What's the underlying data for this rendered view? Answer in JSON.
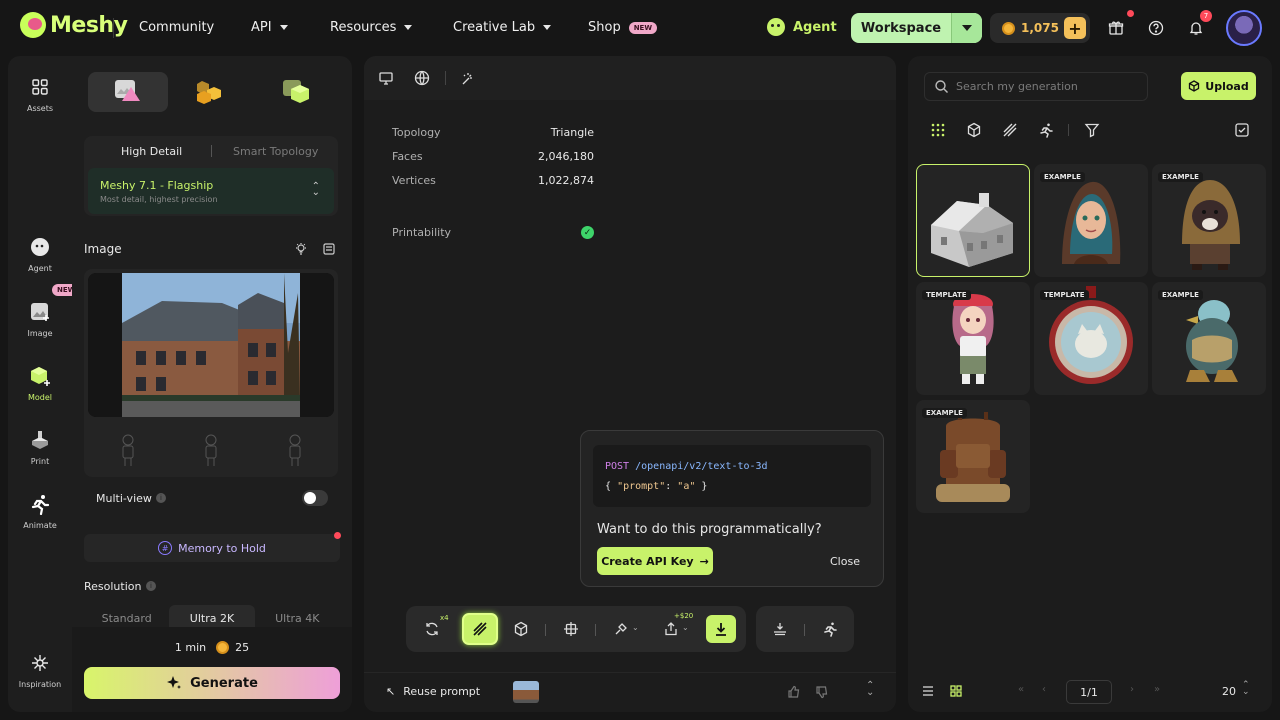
{
  "brand": {
    "name": "Meshy"
  },
  "nav": {
    "items": [
      {
        "label": "Community",
        "has_caret": false
      },
      {
        "label": "API",
        "has_caret": true
      },
      {
        "label": "Resources",
        "has_caret": true
      },
      {
        "label": "Creative Lab",
        "has_caret": true
      },
      {
        "label": "Shop",
        "badge": "NEW"
      }
    ],
    "agent_label": "Agent",
    "workspace_label": "Workspace",
    "credits": "1,075",
    "notification_count": "7"
  },
  "rail": {
    "items": [
      {
        "label": "Assets",
        "icon": "grid-icon"
      },
      {
        "label": "Agent",
        "icon": "agent-icon",
        "badge": "NEW"
      },
      {
        "label": "Image",
        "icon": "image-icon"
      },
      {
        "label": "Model",
        "icon": "cube-icon",
        "active": true
      },
      {
        "label": "Print",
        "icon": "printer-icon"
      },
      {
        "label": "Animate",
        "icon": "running-figure-icon"
      }
    ],
    "bottom": {
      "label": "Inspiration",
      "icon": "sparkle-icon"
    }
  },
  "left_panel": {
    "detail_options": [
      "High Detail",
      "Smart Topology"
    ],
    "model": {
      "name": "Meshy 7.1 - Flagship",
      "description": "Most detail, highest precision"
    },
    "image_label": "Image",
    "multiview_label": "Multi-view",
    "memory_label": "Memory to Hold",
    "resolution_label": "Resolution",
    "resolution_options": [
      "Standard",
      "Ultra 2K",
      "Ultra 4K"
    ],
    "selected_resolution": "Ultra 2K",
    "time_estimate": "1 min",
    "cost": "25",
    "generate_label": "Generate"
  },
  "center": {
    "stats": [
      {
        "key": "Topology",
        "value": "Triangle"
      },
      {
        "key": "Faces",
        "value": "2,046,180"
      },
      {
        "key": "Vertices",
        "value": "1,022,874"
      }
    ],
    "printability_label": "Printability",
    "api_popup": {
      "method": "POST",
      "path": "/openapi/v2/text-to-3d",
      "body_open": "{",
      "body_key": "\"prompt\"",
      "body_colon": ":",
      "body_value": "\"a\"",
      "body_close": "}",
      "question": "Want to do this programmatically?",
      "button_label": "Create API Key",
      "close_label": "Close"
    },
    "toolbar": {
      "remesh_multiplier": "x4",
      "export_price": "+$20"
    },
    "reuse_label": "Reuse prompt"
  },
  "right_panel": {
    "search_placeholder": "Search my generation",
    "upload_label": "Upload",
    "cards": [
      {
        "tag": "",
        "subject": "house-model"
      },
      {
        "tag": "EXAMPLE",
        "subject": "hooded-girl"
      },
      {
        "tag": "EXAMPLE",
        "subject": "hooded-dog"
      },
      {
        "tag": "TEMPLATE",
        "subject": "anime-girl"
      },
      {
        "tag": "TEMPLATE",
        "subject": "cat-medallion"
      },
      {
        "tag": "EXAMPLE",
        "subject": "armored-bird"
      },
      {
        "tag": "EXAMPLE",
        "subject": "leather-backpack"
      }
    ],
    "page": "1/1",
    "page_size": "20"
  },
  "colors": {
    "accent": "#c8f26a",
    "background": "#161616",
    "panel": "#1e1e1e"
  }
}
